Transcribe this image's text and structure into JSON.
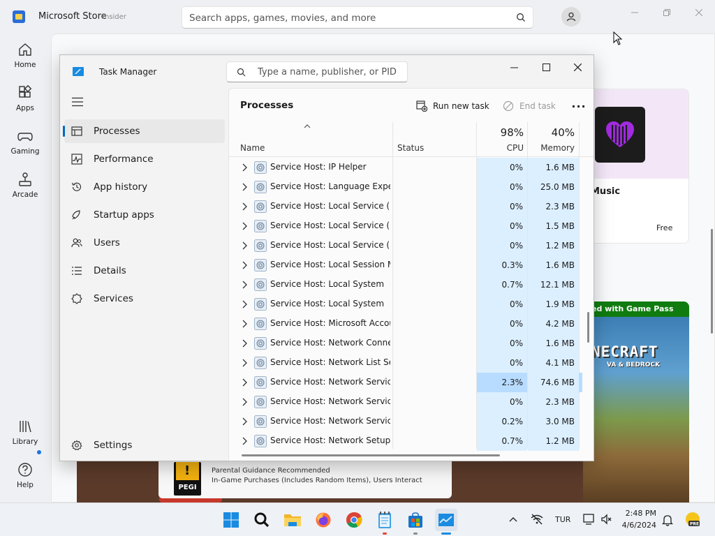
{
  "store": {
    "title": "Microsoft Store",
    "badge": "Insider",
    "search_placeholder": "Search apps, games, movies, and more",
    "nav": [
      {
        "label": "Home",
        "icon": "home-icon"
      },
      {
        "label": "Apps",
        "icon": "apps-icon"
      },
      {
        "label": "Gaming",
        "icon": "gaming-icon"
      },
      {
        "label": "Arcade",
        "icon": "arcade-icon"
      },
      {
        "label": "Library",
        "icon": "library-icon"
      },
      {
        "label": "Help",
        "icon": "help-icon"
      }
    ],
    "music_card": {
      "title": "Music",
      "price": "Free"
    },
    "gamepass_banner": "ed with Game Pass",
    "minecraft_logo": "NECRAFT",
    "minecraft_sub": "VA & BEDROCK",
    "pegi": {
      "badge": "PEGI",
      "line1": "Parental Guidance Recommended",
      "line2": "In-Game Purchases (Includes Random Items), Users Interact"
    },
    "colors": {
      "accent": "#0067c0",
      "gamepass": "#107c10"
    }
  },
  "taskmanager": {
    "title": "Task Manager",
    "search_placeholder": "Type a name, publisher, or PID...",
    "nav": [
      {
        "label": "Processes",
        "icon": "processes-icon",
        "active": true
      },
      {
        "label": "Performance",
        "icon": "performance-icon"
      },
      {
        "label": "App history",
        "icon": "app-history-icon"
      },
      {
        "label": "Startup apps",
        "icon": "startup-apps-icon"
      },
      {
        "label": "Users",
        "icon": "users-icon"
      },
      {
        "label": "Details",
        "icon": "details-icon"
      },
      {
        "label": "Services",
        "icon": "services-icon"
      }
    ],
    "settings_label": "Settings",
    "page_title": "Processes",
    "run_new_task": "Run new task",
    "end_task": "End task",
    "more": "···",
    "columns": {
      "name": "Name",
      "status": "Status",
      "cpu_pct": "98%",
      "cpu": "CPU",
      "mem_pct": "40%",
      "mem": "Memory"
    },
    "rows": [
      {
        "name": "Service Host: IP Helper",
        "cpu": "0%",
        "mem": "1.6 MB"
      },
      {
        "name": "Service Host: Language Experi...",
        "cpu": "0%",
        "mem": "25.0 MB"
      },
      {
        "name": "Service Host: Local Service (N...",
        "cpu": "0%",
        "mem": "2.3 MB"
      },
      {
        "name": "Service Host: Local Service (N...",
        "cpu": "0%",
        "mem": "1.5 MB"
      },
      {
        "name": "Service Host: Local Service (N...",
        "cpu": "0%",
        "mem": "1.2 MB"
      },
      {
        "name": "Service Host: Local Session M...",
        "cpu": "0.3%",
        "mem": "1.6 MB"
      },
      {
        "name": "Service Host: Local System",
        "cpu": "0.7%",
        "mem": "12.1 MB"
      },
      {
        "name": "Service Host: Local System",
        "cpu": "0%",
        "mem": "1.9 MB"
      },
      {
        "name": "Service Host: Microsoft Accou...",
        "cpu": "0%",
        "mem": "4.2 MB"
      },
      {
        "name": "Service Host: Network Connec...",
        "cpu": "0%",
        "mem": "1.6 MB"
      },
      {
        "name": "Service Host: Network List Ser...",
        "cpu": "0%",
        "mem": "4.1 MB"
      },
      {
        "name": "Service Host: Network Service",
        "cpu": "2.3%",
        "mem": "74.6 MB",
        "hot": true
      },
      {
        "name": "Service Host: Network Service",
        "cpu": "0%",
        "mem": "2.3 MB"
      },
      {
        "name": "Service Host: Network Service",
        "cpu": "0.2%",
        "mem": "3.0 MB"
      },
      {
        "name": "Service Host: Network Setup S...",
        "cpu": "0.7%",
        "mem": "1.2 MB"
      }
    ]
  },
  "taskbar": {
    "apps": [
      "start-icon",
      "search-icon",
      "file-explorer-icon",
      "firefox-icon",
      "chrome-icon",
      "notepad-icon",
      "microsoft-store-icon",
      "task-manager-icon"
    ],
    "language": "TUR",
    "time": "2:48 PM",
    "date": "4/6/2024"
  }
}
